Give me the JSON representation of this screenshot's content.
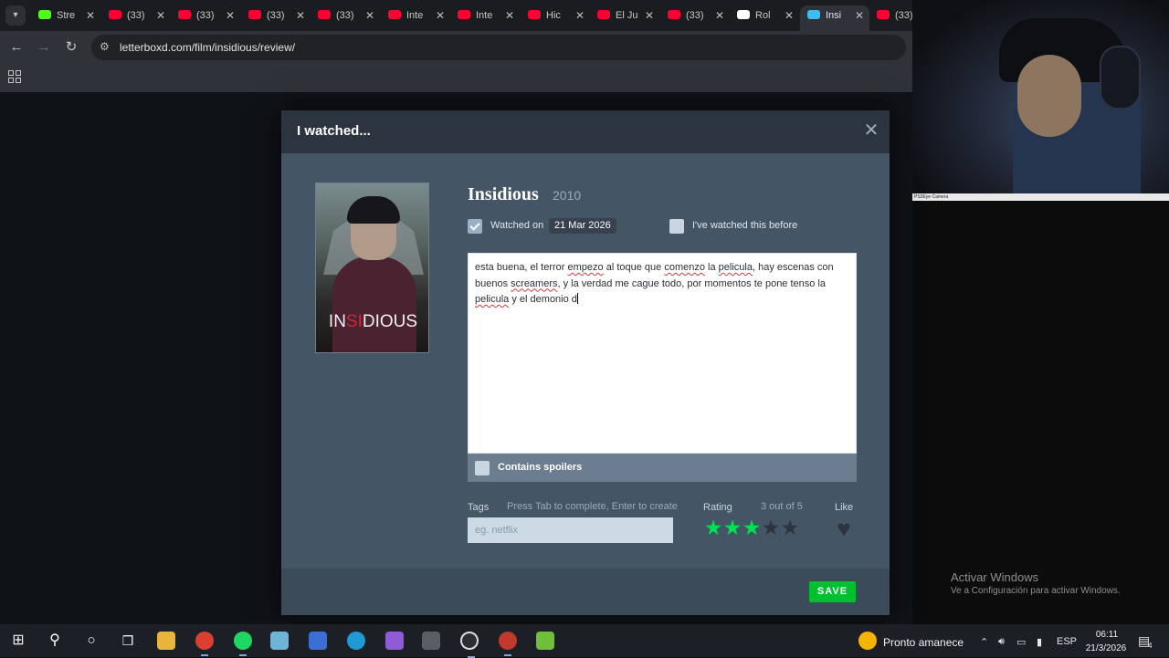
{
  "browser": {
    "tabs": [
      {
        "label": "Stre",
        "icon": "kick-icon",
        "color": "#53fc18"
      },
      {
        "label": "(33)",
        "icon": "youtube-icon",
        "color": "#ff0033"
      },
      {
        "label": "(33)",
        "icon": "youtube-icon",
        "color": "#ff0033"
      },
      {
        "label": "(33)",
        "icon": "youtube-icon",
        "color": "#ff0033"
      },
      {
        "label": "(33)",
        "icon": "youtube-icon",
        "color": "#ff0033"
      },
      {
        "label": "Inte",
        "icon": "youtube-icon",
        "color": "#ff0033"
      },
      {
        "label": "Inte",
        "icon": "youtube-icon",
        "color": "#ff0033"
      },
      {
        "label": "Hic",
        "icon": "youtube-icon",
        "color": "#ff0033"
      },
      {
        "label": "El Ju",
        "icon": "youtube-icon",
        "color": "#ff0033"
      },
      {
        "label": "(33)",
        "icon": "youtube-icon",
        "color": "#ff0033"
      },
      {
        "label": "Rol",
        "icon": "tiktok-icon",
        "color": "#ffffff"
      },
      {
        "label": "Insi",
        "icon": "letterboxd-icon",
        "color": "#40bcf4",
        "active": true
      },
      {
        "label": "(33)",
        "icon": "youtube-icon",
        "color": "#ff0033"
      }
    ],
    "url": "letterboxd.com/film/insidious/review/"
  },
  "modal": {
    "title": "I watched...",
    "film_title": "Insidious",
    "film_year": "2010",
    "poster_title_pre": "IN",
    "poster_title_red": "SI",
    "poster_title_post": "DIOUS",
    "watched_on_label": "Watched on",
    "watched_date": "21 Mar 2026",
    "watched_on_checked": true,
    "rewatch_label": "I've watched this before",
    "rewatch_checked": false,
    "review_segments": [
      {
        "t": "esta buena, el terror "
      },
      {
        "t": "empezo",
        "sp": true
      },
      {
        "t": " al toque que "
      },
      {
        "t": "comenzo",
        "sp": true
      },
      {
        "t": " la "
      },
      {
        "t": "pelicula",
        "sp": true
      },
      {
        "t": ", hay escenas con buenos "
      },
      {
        "t": "screamers",
        "sp": true
      },
      {
        "t": ", y la verdad me cague todo, por momentos te pone tenso la "
      },
      {
        "t": "pelicula",
        "sp": true
      },
      {
        "t": " y el demonio d"
      }
    ],
    "spoilers_label": "Contains spoilers",
    "spoilers_checked": false,
    "tags_label": "Tags",
    "tags_hint": "Press Tab to complete, Enter to create",
    "tags_placeholder": "eg. netflix",
    "rating_label": "Rating",
    "rating_value_text": "3 out of 5",
    "rating": 3,
    "rating_max": 5,
    "like_label": "Like",
    "liked": false,
    "save_label": "SAVE",
    "accent_green": "#00e054"
  },
  "webcam_label": "PS3Eye Camera",
  "watermark": {
    "title": "Activar Windows",
    "subtitle": "Ve a Configuración para activar Windows."
  },
  "taskbar": {
    "weather": "Pronto amanece",
    "language": "ESP",
    "time": "06:11",
    "date": "21/3/2026",
    "notification_count": "4"
  }
}
